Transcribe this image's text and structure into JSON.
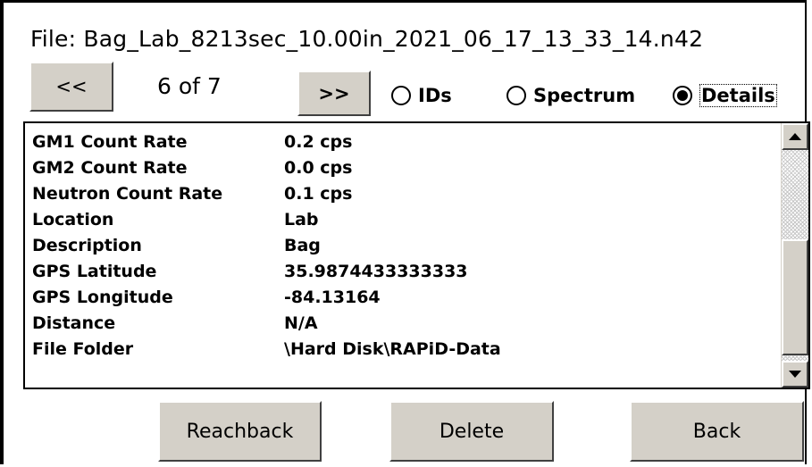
{
  "header": {
    "file_label": "File: Bag_Lab_8213sec_10.00in_2021_06_17_13_33_14.n42"
  },
  "nav": {
    "prev_label": "<<",
    "next_label": ">>",
    "counter": "6 of 7"
  },
  "view_options": [
    {
      "label": "IDs",
      "selected": false
    },
    {
      "label": "Spectrum",
      "selected": false
    },
    {
      "label": "Details",
      "selected": true
    }
  ],
  "details": [
    {
      "key": "GM1 Count Rate",
      "value": "0.2 cps"
    },
    {
      "key": "GM2 Count Rate",
      "value": "0.0 cps"
    },
    {
      "key": "Neutron Count Rate",
      "value": "0.1 cps"
    },
    {
      "key": "Location",
      "value": "Lab"
    },
    {
      "key": "Description",
      "value": "Bag"
    },
    {
      "key": "GPS Latitude",
      "value": "35.9874433333333"
    },
    {
      "key": "GPS Longitude",
      "value": "-84.13164"
    },
    {
      "key": "Distance",
      "value": "N/A"
    },
    {
      "key": "File Folder",
      "value": "\\Hard Disk\\RAPiD-Data"
    }
  ],
  "actions": {
    "reachback_label": "Reachback",
    "delete_label": "Delete",
    "back_label": "Back"
  },
  "icons": {
    "scroll_up": "scroll-up-arrow-icon",
    "scroll_down": "scroll-down-arrow-icon"
  }
}
